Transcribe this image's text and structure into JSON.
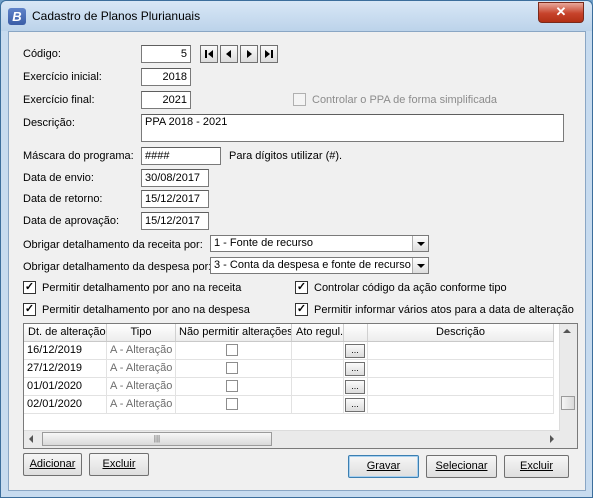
{
  "window": {
    "title": "Cadastro de Planos Plurianuais",
    "icon_letter": "B",
    "close_glyph": "✕"
  },
  "form": {
    "codigo_label": "Código:",
    "codigo_value": "5",
    "exercicio_inicial_label": "Exercício inicial:",
    "exercicio_inicial_value": "2018",
    "exercicio_final_label": "Exercício final:",
    "exercicio_final_value": "2021",
    "controlar_ppa_label": "Controlar o PPA de forma simplificada",
    "descricao_label": "Descrição:",
    "descricao_value": "PPA 2018 - 2021",
    "mascara_label": "Máscara do programa:",
    "mascara_value": "####",
    "mascara_hint": "Para dígitos utilizar (#).",
    "data_envio_label": "Data de envio:",
    "data_envio_value": "30/08/2017",
    "data_retorno_label": "Data de retorno:",
    "data_retorno_value": "15/12/2017",
    "data_aprovacao_label": "Data de aprovação:",
    "data_aprovacao_value": "15/12/2017",
    "receita_label": "Obrigar detalhamento da receita por:",
    "receita_value": "1 - Fonte de recurso",
    "despesa_label": "Obrigar detalhamento da despesa por:",
    "despesa_value": "3 - Conta da despesa e fonte de recurso",
    "chk_ano_receita": "Permitir detalhamento por ano na receita",
    "chk_codigo_acao": "Controlar código da ação conforme tipo",
    "chk_ano_despesa": "Permitir detalhamento por ano na despesa",
    "chk_varios_atos": "Permitir informar vários atos para a data de alteração",
    "check_glyph": "✓"
  },
  "nav": {
    "first": "first-record-icon",
    "prev": "previous-record-icon",
    "next": "next-record-icon",
    "last": "last-record-icon"
  },
  "grid": {
    "headers": [
      "Dt. de alteração",
      "Tipo",
      "Não permitir alterações",
      "Ato regul.",
      "Descrição"
    ],
    "rows": [
      {
        "date": "16/12/2019",
        "tipo": "A - Alteração"
      },
      {
        "date": "27/12/2019",
        "tipo": "A - Alteração"
      },
      {
        "date": "01/01/2020",
        "tipo": "A - Alteração"
      },
      {
        "date": "02/01/2020",
        "tipo": "A - Alteração"
      }
    ],
    "dots_label": "...",
    "hthumb_grip": "|||"
  },
  "buttons": {
    "adicionar": "Adicionar",
    "excluir_grid": "Excluir",
    "gravar": "Gravar",
    "selecionar": "Selecionar",
    "excluir": "Excluir"
  }
}
